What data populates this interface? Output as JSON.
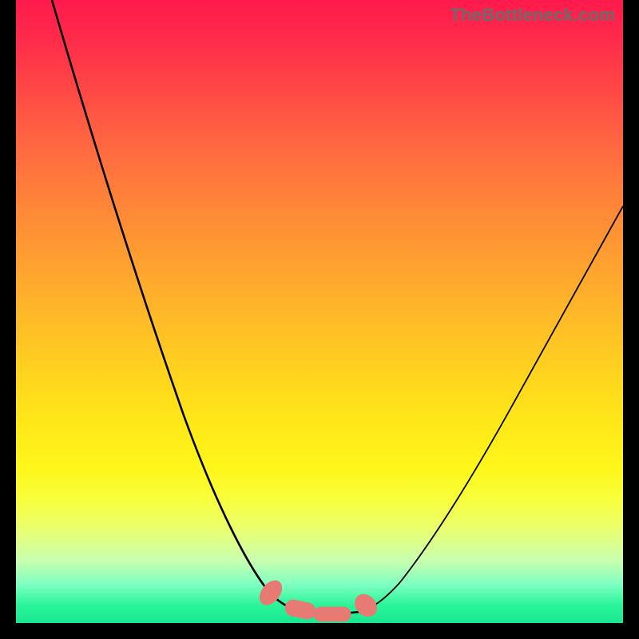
{
  "watermark": {
    "text": "TheBottleneck.com"
  },
  "colors": {
    "curve": "#000000",
    "marker_fill": "#e77b73",
    "marker_stroke": "#d4645d",
    "frame": "#000000"
  },
  "chart_data": {
    "type": "line",
    "title": "",
    "xlabel": "",
    "ylabel": "",
    "xlim": [
      0,
      100
    ],
    "ylim": [
      0,
      100
    ],
    "series": [
      {
        "name": "left-branch",
        "x": [
          6,
          10,
          14,
          18,
          22,
          26,
          30,
          34,
          37,
          40,
          42,
          44,
          46
        ],
        "y": [
          100,
          88,
          76,
          64,
          52,
          41,
          30,
          20,
          12,
          7,
          4,
          2.5,
          2
        ]
      },
      {
        "name": "floor",
        "x": [
          46,
          49,
          52,
          55,
          57
        ],
        "y": [
          2,
          1.8,
          1.8,
          1.9,
          2.1
        ]
      },
      {
        "name": "right-branch",
        "x": [
          57,
          60,
          64,
          70,
          76,
          82,
          88,
          94,
          100
        ],
        "y": [
          2.1,
          4,
          8,
          16,
          25,
          35,
          45,
          56,
          67
        ]
      }
    ],
    "annotations": [
      {
        "name": "bottom-markers",
        "type": "scatter",
        "x": [
          42.5,
          46,
          49,
          52,
          55,
          57.5
        ],
        "y": [
          3.5,
          2.2,
          1.9,
          1.9,
          2.1,
          3.0
        ]
      }
    ]
  }
}
